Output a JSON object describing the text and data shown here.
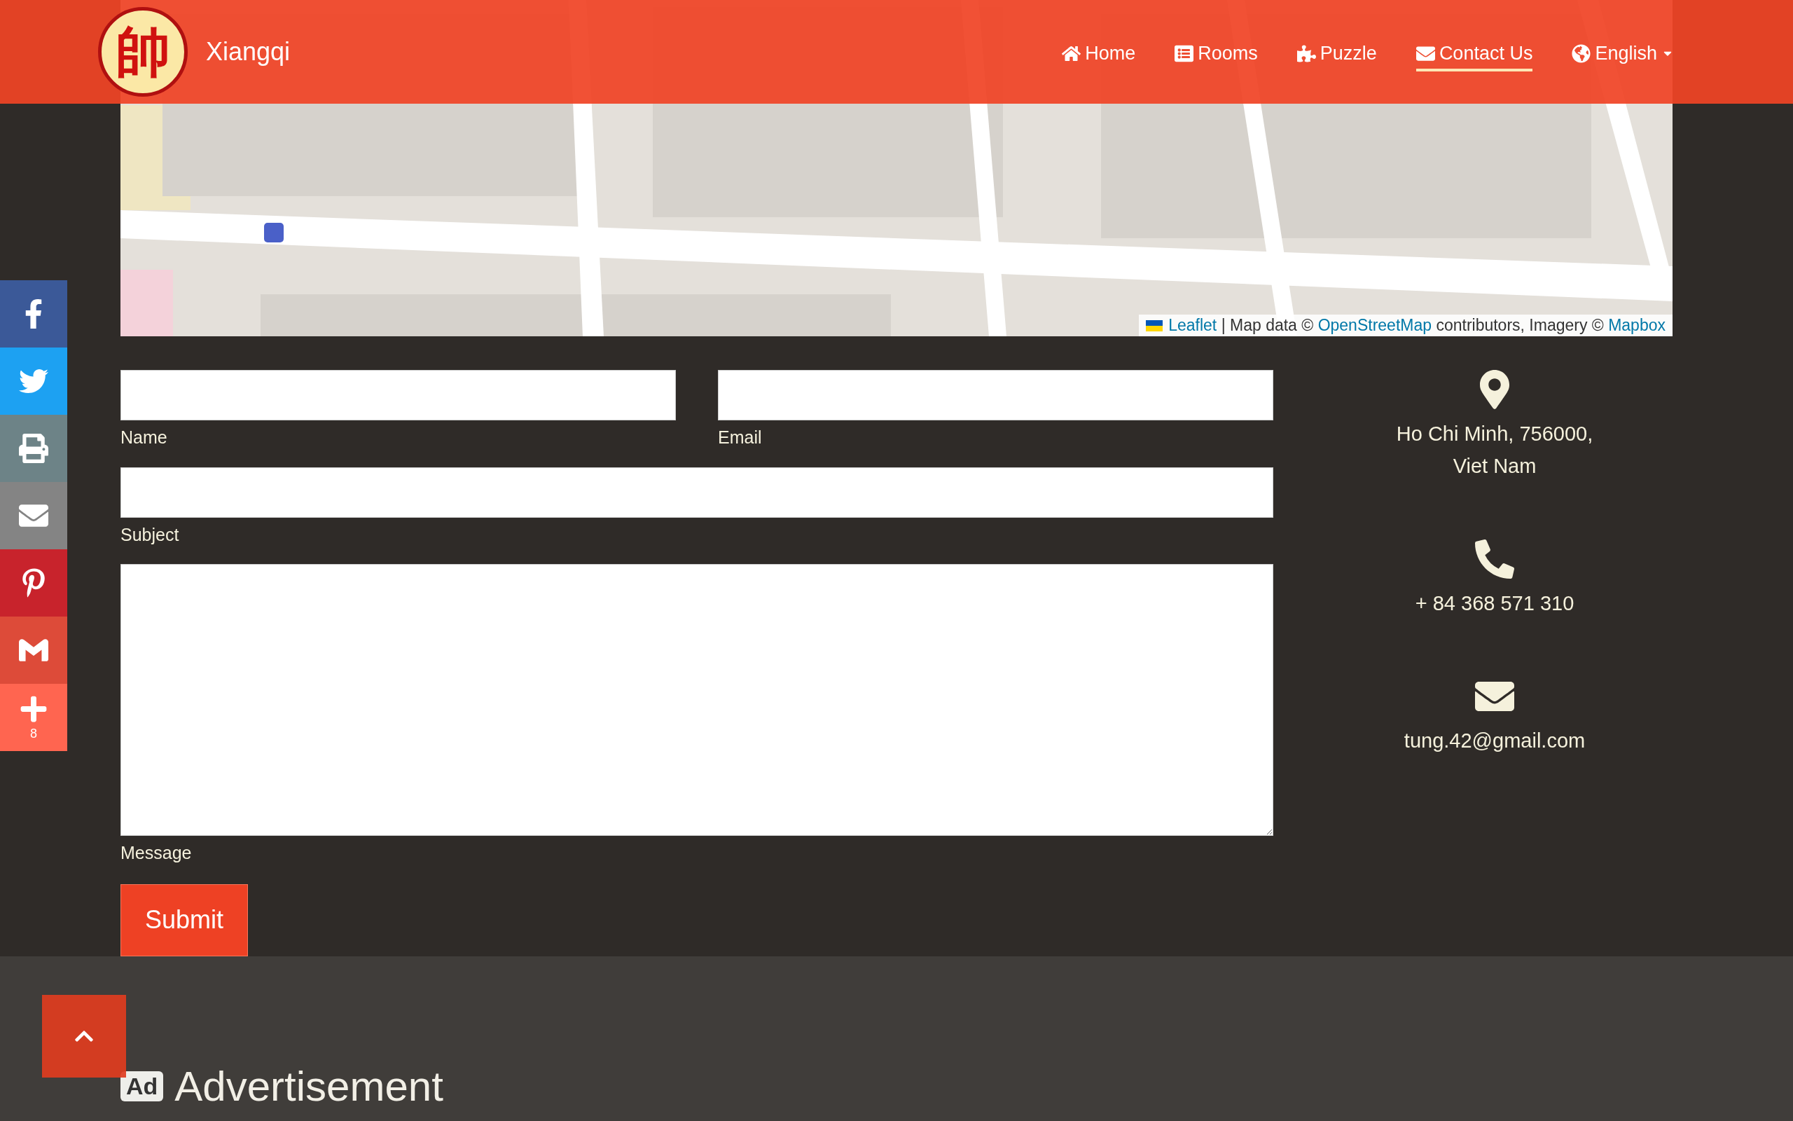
{
  "header": {
    "logo_character": "帥",
    "site_name": "Xiangqi",
    "nav": [
      {
        "kind": "home",
        "label": "Home",
        "selected": false
      },
      {
        "kind": "rooms",
        "label": "Rooms",
        "selected": false
      },
      {
        "kind": "puzzle",
        "label": "Puzzle",
        "selected": false
      },
      {
        "kind": "contact",
        "label": "Contact Us",
        "selected": true
      },
      {
        "kind": "language",
        "label": "English",
        "selected": false
      }
    ]
  },
  "map": {
    "attribution": [
      {
        "text": "Leaflet",
        "link": true
      },
      {
        "text": " | Map data © ",
        "link": false
      },
      {
        "text": "OpenStreetMap",
        "link": true
      },
      {
        "text": " contributors, Imagery © ",
        "link": false
      },
      {
        "text": "Mapbox",
        "link": true
      }
    ]
  },
  "share_bar": [
    {
      "kind": "facebook",
      "color": "#3b5998"
    },
    {
      "kind": "twitter",
      "color": "#1da1f2"
    },
    {
      "kind": "print",
      "color": "#6d8387"
    },
    {
      "kind": "email",
      "color": "#848484"
    },
    {
      "kind": "pinterest",
      "color": "#c8232c"
    },
    {
      "kind": "gmail",
      "color": "#dd4b39"
    },
    {
      "kind": "more",
      "color": "#ff6550",
      "count": "8"
    }
  ],
  "form": {
    "fields": [
      {
        "kind": "input",
        "label": "Name"
      },
      {
        "kind": "input",
        "label": "Email"
      },
      {
        "kind": "input",
        "label": "Subject"
      },
      {
        "kind": "textarea",
        "label": "Message"
      }
    ],
    "submit": "Submit"
  },
  "contact": [
    {
      "kind": "location",
      "lines": [
        "Ho Chi Minh, 756000,",
        "Viet Nam"
      ]
    },
    {
      "kind": "phone",
      "lines": [
        "+ 84 368 571 310"
      ]
    },
    {
      "kind": "email",
      "lines": [
        "tung.42@gmail.com"
      ]
    }
  ],
  "footer": {
    "badge": "Ad",
    "heading": "Advertisement"
  }
}
